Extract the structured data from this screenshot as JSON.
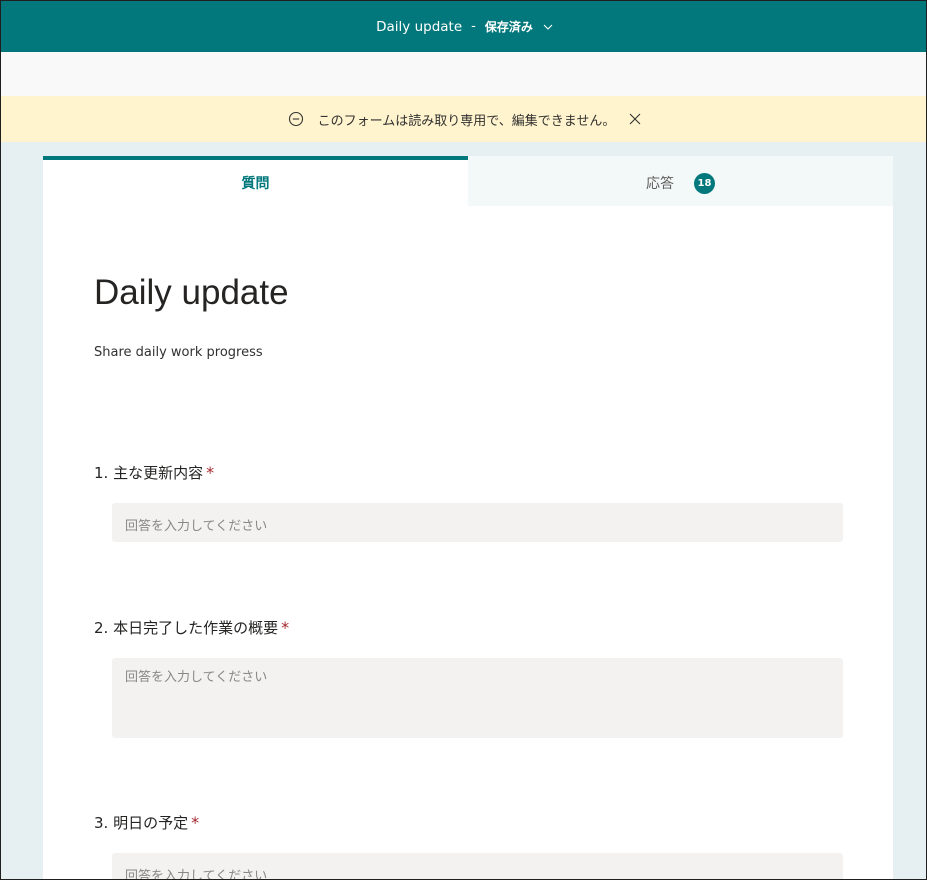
{
  "topbar": {
    "title": "Daily update",
    "separator": "-",
    "status": "保存済み"
  },
  "notice": {
    "text": "このフォームは読み取り専用で、編集できません。"
  },
  "tabs": {
    "questions_label": "質問",
    "responses_label": "応答",
    "responses_count": "18"
  },
  "form": {
    "title": "Daily update",
    "description": "Share daily work progress",
    "questions": [
      {
        "label": "1. 主な更新内容",
        "required_mark": "*",
        "placeholder": "回答を入力してください"
      },
      {
        "label": "2. 本日完了した作業の概要",
        "required_mark": "*",
        "placeholder": "回答を入力してください"
      },
      {
        "label": "3. 明日の予定",
        "required_mark": "*",
        "placeholder": "回答を入力してください"
      }
    ]
  },
  "colors": {
    "brand": "#03787c",
    "notice_bg": "#fff4ce",
    "required": "#a4262c"
  }
}
